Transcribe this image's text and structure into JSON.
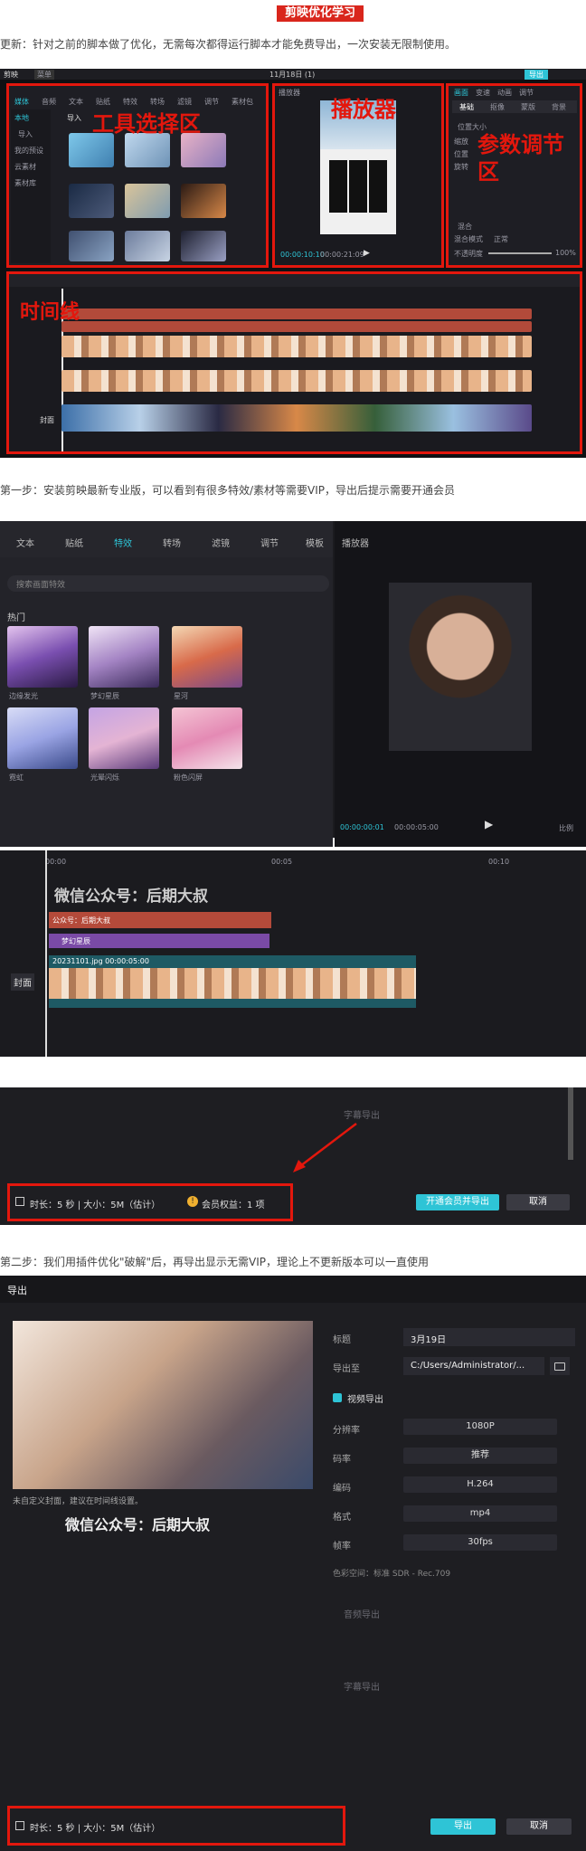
{
  "article": {
    "title": "剪映优化学习",
    "update_note": "更新：针对之前的脚本做了优化，无需每次都得运行脚本才能免费导出，一次安装无限制使用。",
    "step1": "第一步：安装剪映最新专业版，可以看到有很多特效/素材等需要VIP，导出后提示需要开通会员",
    "step2": "第二步：我们用插件优化\"破解\"后，再导出显示无需VIP，理论上不更新版本可以一直使用"
  },
  "editor_overview": {
    "app_name": "剪映",
    "menu": "菜单",
    "project_title": "11月18日 (1)",
    "export_label": "导出",
    "annotations": {
      "tools": "工具选择区",
      "player": "播放器",
      "params": "参数调节区",
      "timeline": "时间线"
    },
    "tool_tabs": [
      "媒体",
      "音频",
      "文本",
      "贴纸",
      "特效",
      "转场",
      "滤镜",
      "调节",
      "素材包"
    ],
    "side_items": [
      "本地",
      "导入",
      "我的预设",
      "云素材",
      "素材库"
    ],
    "import_label": "导入",
    "player_label": "播放器",
    "time_current": "00:00:10:10",
    "time_total": "00:00:21:09",
    "param_tabs": [
      "画面",
      "变速",
      "动画",
      "调节"
    ],
    "param_sub": [
      "基础",
      "抠像",
      "蒙版",
      "背景"
    ],
    "param_rows": [
      "位置大小",
      "缩放",
      "位置",
      "旋转",
      "混合",
      "混合模式",
      "不透明度"
    ],
    "param_values": {
      "blend_mode": "正常",
      "opacity": "100%"
    },
    "track_labels": [
      "封面"
    ],
    "clip_prefix": "1.jpg"
  },
  "vip_editor": {
    "tabs": [
      "文本",
      "贴纸",
      "特效",
      "转场",
      "滤镜",
      "调节",
      "模板"
    ],
    "search_placeholder": "搜索画面特效",
    "section": "热门",
    "effects": [
      "边缘发光",
      "梦幻星辰",
      "星河",
      "霓虹",
      "光晕闪烁",
      "粉色闪屏"
    ],
    "player_label": "播放器",
    "time_current": "00:00:00:01",
    "time_total": "00:00:05:00",
    "ratio_label": "比例",
    "watermark": "微信公众号：后期大叔",
    "ruler": [
      "00:00",
      "00:05",
      "00:10"
    ],
    "track1": "公众号：后期大叔",
    "track2": "梦幻星辰",
    "clip_label": "20231101.jpg 00:00:05:00",
    "cover_label": "封面"
  },
  "export_vip": {
    "section": "字幕导出",
    "duration_label": "时长：5 秒 | 大小：5M（估计）",
    "vip_label": "会员权益：1 项",
    "vip_button": "开通会员并导出",
    "cancel": "取消"
  },
  "export_free": {
    "window_title": "导出",
    "cover_note": "未自定义封面，建议在时间线设置。",
    "watermark": "微信公众号：后期大叔",
    "title_label": "标题",
    "title_value": "3月19日",
    "export_to_label": "导出至",
    "export_to_value": "C:/Users/Administrator/...",
    "video_export": "视频导出",
    "rows": [
      {
        "label": "分辨率",
        "value": "1080P"
      },
      {
        "label": "码率",
        "value": "推荐"
      },
      {
        "label": "编码",
        "value": "H.264"
      },
      {
        "label": "格式",
        "value": "mp4"
      },
      {
        "label": "帧率",
        "value": "30fps"
      }
    ],
    "color_space": "色彩空间：标准 SDR - Rec.709",
    "audio_export": "音频导出",
    "subtitle_export": "字幕导出",
    "duration_label": "时长：5 秒 | 大小：5M（估计）",
    "export_button": "导出",
    "cancel": "取消"
  },
  "colors": {
    "accent": "#2ec4d6",
    "highlight": "#e3170d",
    "dark": "#1b1b1f"
  }
}
